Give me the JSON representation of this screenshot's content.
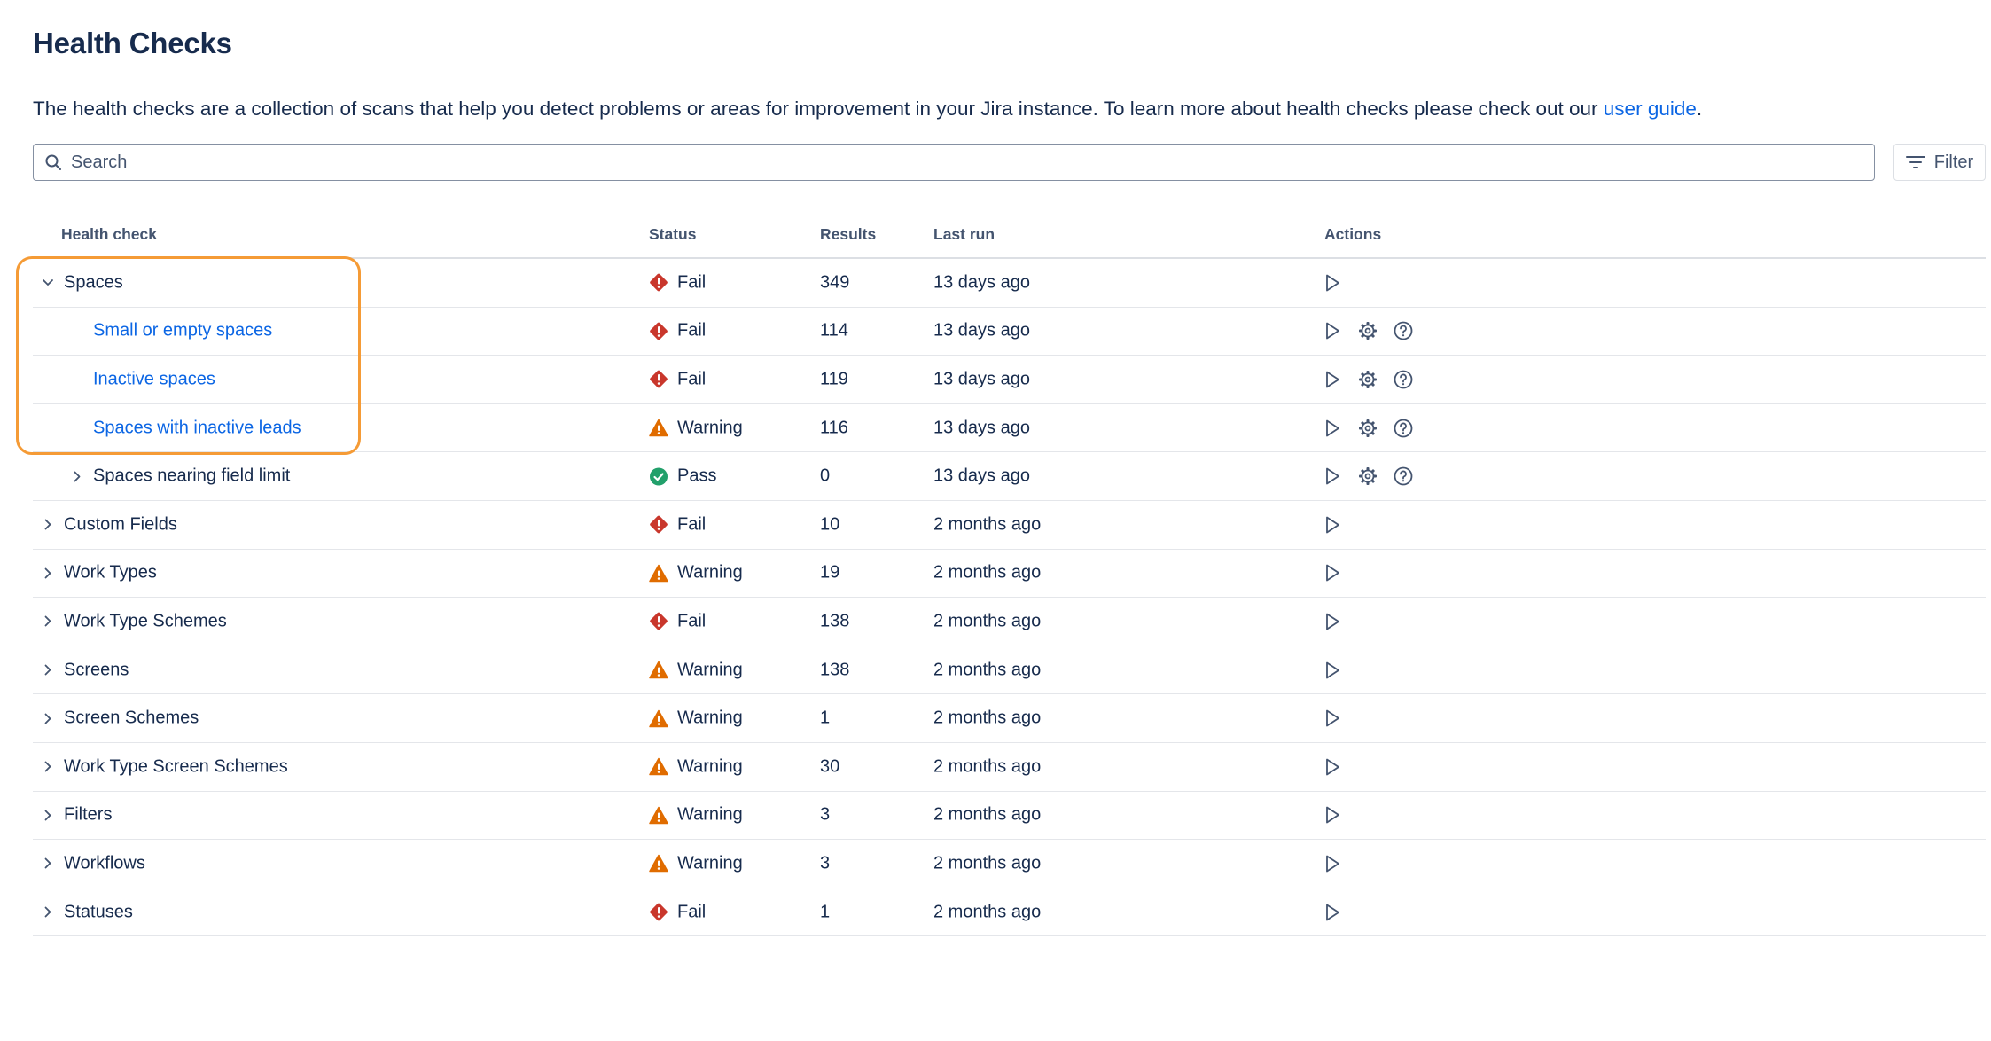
{
  "page": {
    "title": "Health Checks",
    "intro_text": "The health checks are a collection of scans that help you detect problems or areas for improvement in your Jira instance. To learn more about health checks please check out our ",
    "intro_link": "user guide",
    "intro_end": "."
  },
  "search": {
    "placeholder": "Search",
    "value": ""
  },
  "filter": {
    "label": "Filter"
  },
  "table": {
    "headers": {
      "name": "Health check",
      "status": "Status",
      "results": "Results",
      "last_run": "Last run",
      "actions": "Actions"
    },
    "rows": [
      {
        "name": "Spaces",
        "level": 0,
        "chevron": "down",
        "link": false,
        "status": "Fail",
        "results": "349",
        "last_run": "13 days ago",
        "actions": [
          "run"
        ]
      },
      {
        "name": "Small or empty spaces",
        "level": 1,
        "chevron": "none",
        "link": true,
        "status": "Fail",
        "results": "114",
        "last_run": "13 days ago",
        "actions": [
          "run",
          "settings",
          "help"
        ]
      },
      {
        "name": "Inactive spaces",
        "level": 1,
        "chevron": "none",
        "link": true,
        "status": "Fail",
        "results": "119",
        "last_run": "13 days ago",
        "actions": [
          "run",
          "settings",
          "help"
        ]
      },
      {
        "name": "Spaces with inactive leads",
        "level": 1,
        "chevron": "none",
        "link": true,
        "status": "Warning",
        "results": "116",
        "last_run": "13 days ago",
        "actions": [
          "run",
          "settings",
          "help"
        ]
      },
      {
        "name": "Spaces nearing field limit",
        "level": 1,
        "chevron": "right",
        "link": false,
        "status": "Pass",
        "results": "0",
        "last_run": "13 days ago",
        "actions": [
          "run",
          "settings",
          "help"
        ]
      },
      {
        "name": "Custom Fields",
        "level": 0,
        "chevron": "right",
        "link": false,
        "status": "Fail",
        "results": "10",
        "last_run": "2 months ago",
        "actions": [
          "run"
        ]
      },
      {
        "name": "Work Types",
        "level": 0,
        "chevron": "right",
        "link": false,
        "status": "Warning",
        "results": "19",
        "last_run": "2 months ago",
        "actions": [
          "run"
        ]
      },
      {
        "name": "Work Type Schemes",
        "level": 0,
        "chevron": "right",
        "link": false,
        "status": "Fail",
        "results": "138",
        "last_run": "2 months ago",
        "actions": [
          "run"
        ]
      },
      {
        "name": "Screens",
        "level": 0,
        "chevron": "right",
        "link": false,
        "status": "Warning",
        "results": "138",
        "last_run": "2 months ago",
        "actions": [
          "run"
        ]
      },
      {
        "name": "Screen Schemes",
        "level": 0,
        "chevron": "right",
        "link": false,
        "status": "Warning",
        "results": "1",
        "last_run": "2 months ago",
        "actions": [
          "run"
        ]
      },
      {
        "name": "Work Type Screen Schemes",
        "level": 0,
        "chevron": "right",
        "link": false,
        "status": "Warning",
        "results": "30",
        "last_run": "2 months ago",
        "actions": [
          "run"
        ]
      },
      {
        "name": "Filters",
        "level": 0,
        "chevron": "right",
        "link": false,
        "status": "Warning",
        "results": "3",
        "last_run": "2 months ago",
        "actions": [
          "run"
        ]
      },
      {
        "name": "Workflows",
        "level": 0,
        "chevron": "right",
        "link": false,
        "status": "Warning",
        "results": "3",
        "last_run": "2 months ago",
        "actions": [
          "run"
        ]
      },
      {
        "name": "Statuses",
        "level": 0,
        "chevron": "right",
        "link": false,
        "status": "Fail",
        "results": "1",
        "last_run": "2 months ago",
        "actions": [
          "run"
        ]
      }
    ]
  },
  "colors": {
    "fail": "#c9372c",
    "warning": "#e06c00",
    "pass": "#22a06b",
    "link": "#0c66e4",
    "highlight": "#f59b36"
  },
  "icons": {
    "search": "search-icon",
    "filter": "filter-lines-icon",
    "fail": "error-diamond-icon",
    "warning": "warning-triangle-icon",
    "pass": "check-circle-icon",
    "run": "play-icon",
    "settings": "gear-icon",
    "help": "question-circle-icon"
  }
}
